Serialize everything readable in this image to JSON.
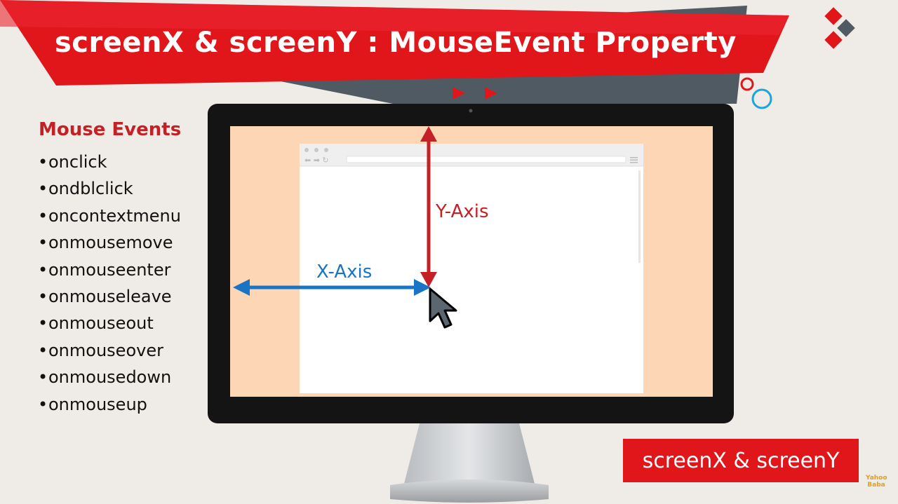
{
  "title": "screenX & screenY : MouseEvent Property",
  "mouse_events": {
    "heading": "Mouse Events",
    "items": [
      "onclick",
      "ondblclick",
      "oncontextmenu",
      "onmousemove",
      "onmouseenter",
      "onmouseleave",
      "onmouseout",
      "onmouseover",
      "onmousedown",
      "onmouseup"
    ]
  },
  "diagram": {
    "y_axis_label": "Y-Axis",
    "x_axis_label": "X-Axis"
  },
  "badge_text": "screenX & screenY",
  "logo": {
    "line1": "Yahoo",
    "line2": "Baba"
  },
  "colors": {
    "banner_red": "#e0161b",
    "banner_dark": "#505a63",
    "screen_peach": "#fdd7b5",
    "y_axis": "#c42126",
    "x_axis": "#1a74c6"
  },
  "icons": [
    "diamond-logo-icon",
    "play-arrows-icon",
    "circles-decoration-icon",
    "mouse-cursor-icon",
    "browser-menu-icon"
  ]
}
